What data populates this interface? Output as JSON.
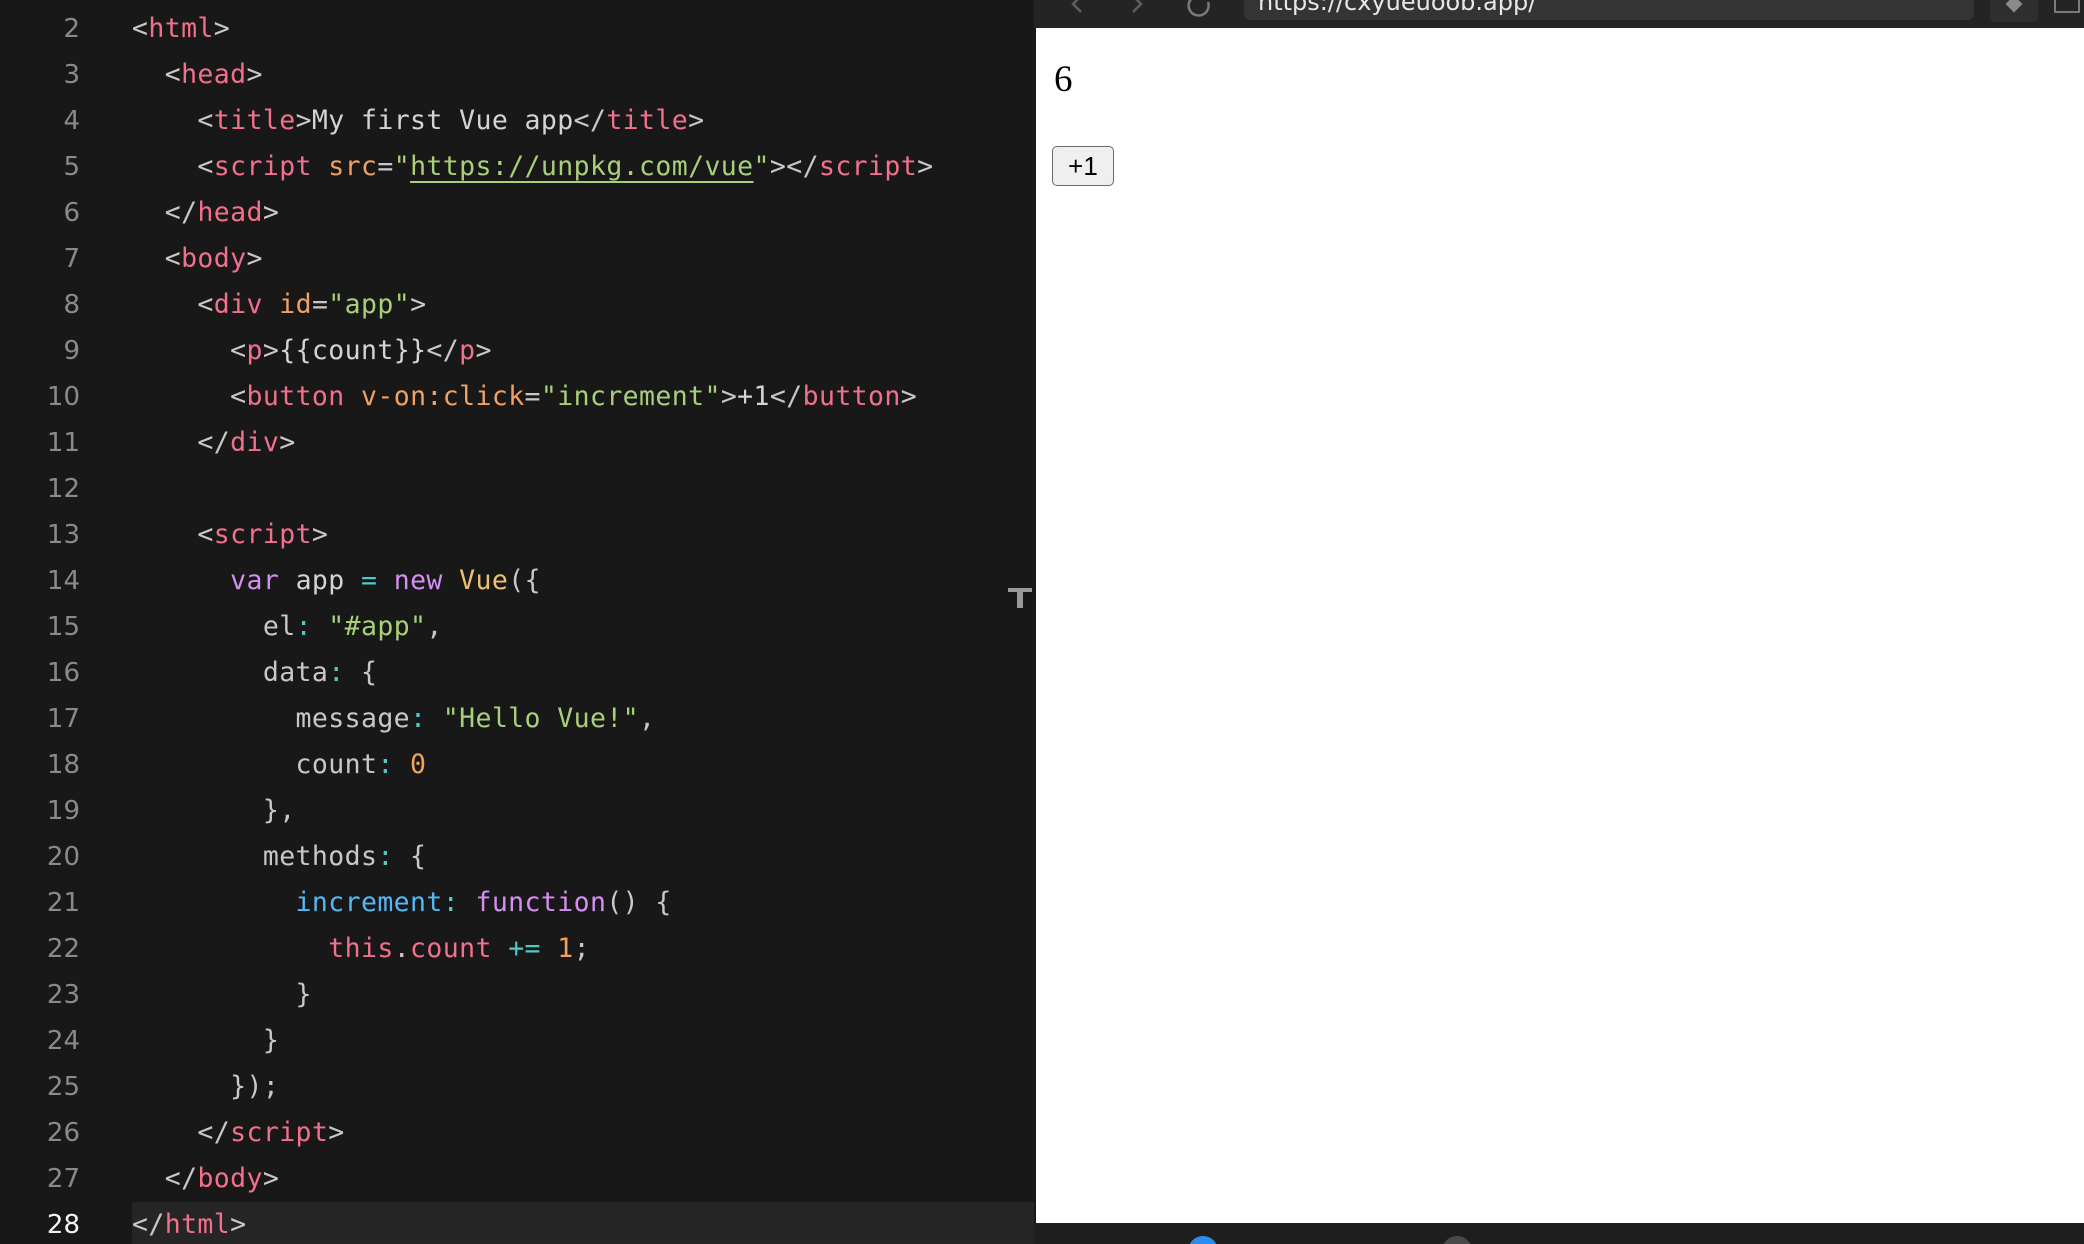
{
  "editor": {
    "current_line": 28,
    "lines": [
      {
        "n": "2",
        "tokens": [
          [
            "t-punct",
            "<"
          ],
          [
            "t-tag",
            "html"
          ],
          [
            "t-punct",
            ">"
          ]
        ]
      },
      {
        "n": "3",
        "tokens": [
          [
            "t-text",
            "  "
          ],
          [
            "t-punct",
            "<"
          ],
          [
            "t-tag",
            "head"
          ],
          [
            "t-punct",
            ">"
          ]
        ]
      },
      {
        "n": "4",
        "tokens": [
          [
            "t-text",
            "    "
          ],
          [
            "t-punct",
            "<"
          ],
          [
            "t-tag",
            "title"
          ],
          [
            "t-punct",
            ">"
          ],
          [
            "t-text",
            "My first Vue app"
          ],
          [
            "t-punct",
            "</"
          ],
          [
            "t-tag",
            "title"
          ],
          [
            "t-punct",
            ">"
          ]
        ]
      },
      {
        "n": "5",
        "tokens": [
          [
            "t-text",
            "    "
          ],
          [
            "t-punct",
            "<"
          ],
          [
            "t-tag",
            "script"
          ],
          [
            "t-text",
            " "
          ],
          [
            "t-attr",
            "src"
          ],
          [
            "t-punct",
            "="
          ],
          [
            "t-string",
            "\""
          ],
          [
            "t-link",
            "https://unpkg.com/vue"
          ],
          [
            "t-string",
            "\""
          ],
          [
            "t-punct",
            "></"
          ],
          [
            "t-tag",
            "script"
          ],
          [
            "t-punct",
            ">"
          ]
        ]
      },
      {
        "n": "6",
        "tokens": [
          [
            "t-text",
            "  "
          ],
          [
            "t-punct",
            "</"
          ],
          [
            "t-tag",
            "head"
          ],
          [
            "t-punct",
            ">"
          ]
        ]
      },
      {
        "n": "7",
        "tokens": [
          [
            "t-text",
            "  "
          ],
          [
            "t-punct",
            "<"
          ],
          [
            "t-tag",
            "body"
          ],
          [
            "t-punct",
            ">"
          ]
        ]
      },
      {
        "n": "8",
        "tokens": [
          [
            "t-text",
            "    "
          ],
          [
            "t-punct",
            "<"
          ],
          [
            "t-tag",
            "div"
          ],
          [
            "t-text",
            " "
          ],
          [
            "t-attr",
            "id"
          ],
          [
            "t-punct",
            "="
          ],
          [
            "t-string",
            "\"app\""
          ],
          [
            "t-punct",
            ">"
          ]
        ]
      },
      {
        "n": "9",
        "tokens": [
          [
            "t-text",
            "      "
          ],
          [
            "t-punct",
            "<"
          ],
          [
            "t-tag",
            "p"
          ],
          [
            "t-punct",
            ">"
          ],
          [
            "t-text",
            "{{count}}"
          ],
          [
            "t-punct",
            "</"
          ],
          [
            "t-tag",
            "p"
          ],
          [
            "t-punct",
            ">"
          ]
        ]
      },
      {
        "n": "10",
        "tokens": [
          [
            "t-text",
            "      "
          ],
          [
            "t-punct",
            "<"
          ],
          [
            "t-tag",
            "button"
          ],
          [
            "t-text",
            " "
          ],
          [
            "t-attr",
            "v-on:click"
          ],
          [
            "t-punct",
            "="
          ],
          [
            "t-string",
            "\"increment\""
          ],
          [
            "t-punct",
            ">"
          ],
          [
            "t-text",
            "+1"
          ],
          [
            "t-punct",
            "</"
          ],
          [
            "t-tag",
            "button"
          ],
          [
            "t-punct",
            ">"
          ]
        ]
      },
      {
        "n": "11",
        "tokens": [
          [
            "t-text",
            "    "
          ],
          [
            "t-punct",
            "</"
          ],
          [
            "t-tag",
            "div"
          ],
          [
            "t-punct",
            ">"
          ]
        ]
      },
      {
        "n": "12",
        "tokens": []
      },
      {
        "n": "13",
        "tokens": [
          [
            "t-text",
            "    "
          ],
          [
            "t-punct",
            "<"
          ],
          [
            "t-tag",
            "script"
          ],
          [
            "t-punct",
            ">"
          ]
        ]
      },
      {
        "n": "14",
        "tokens": [
          [
            "t-text",
            "      "
          ],
          [
            "t-keyword",
            "var"
          ],
          [
            "t-text",
            " app "
          ],
          [
            "t-op",
            "="
          ],
          [
            "t-text",
            " "
          ],
          [
            "t-keyword",
            "new"
          ],
          [
            "t-text",
            " "
          ],
          [
            "t-class",
            "Vue"
          ],
          [
            "t-punct",
            "({"
          ]
        ]
      },
      {
        "n": "15",
        "tokens": [
          [
            "t-text",
            "        "
          ],
          [
            "t-prop",
            "el"
          ],
          [
            "t-op",
            ":"
          ],
          [
            "t-text",
            " "
          ],
          [
            "t-string",
            "\"#app\""
          ],
          [
            "t-punct",
            ","
          ]
        ]
      },
      {
        "n": "16",
        "tokens": [
          [
            "t-text",
            "        "
          ],
          [
            "t-prop",
            "data"
          ],
          [
            "t-op",
            ":"
          ],
          [
            "t-text",
            " "
          ],
          [
            "t-punct",
            "{"
          ]
        ]
      },
      {
        "n": "17",
        "tokens": [
          [
            "t-text",
            "          "
          ],
          [
            "t-prop",
            "message"
          ],
          [
            "t-op",
            ":"
          ],
          [
            "t-text",
            " "
          ],
          [
            "t-string",
            "\"Hello Vue!\""
          ],
          [
            "t-punct",
            ","
          ]
        ]
      },
      {
        "n": "18",
        "tokens": [
          [
            "t-text",
            "          "
          ],
          [
            "t-prop",
            "count"
          ],
          [
            "t-op",
            ":"
          ],
          [
            "t-text",
            " "
          ],
          [
            "t-number",
            "0"
          ]
        ]
      },
      {
        "n": "19",
        "tokens": [
          [
            "t-text",
            "        "
          ],
          [
            "t-punct",
            "},"
          ]
        ]
      },
      {
        "n": "20",
        "tokens": [
          [
            "t-text",
            "        "
          ],
          [
            "t-prop",
            "methods"
          ],
          [
            "t-op",
            ":"
          ],
          [
            "t-text",
            " "
          ],
          [
            "t-punct",
            "{"
          ]
        ]
      },
      {
        "n": "21",
        "tokens": [
          [
            "t-text",
            "          "
          ],
          [
            "t-func",
            "increment"
          ],
          [
            "t-op",
            ":"
          ],
          [
            "t-text",
            " "
          ],
          [
            "t-keyword",
            "function"
          ],
          [
            "t-punct",
            "() {"
          ]
        ]
      },
      {
        "n": "22",
        "tokens": [
          [
            "t-text",
            "            "
          ],
          [
            "t-this",
            "this"
          ],
          [
            "t-punct",
            "."
          ],
          [
            "t-this",
            "count"
          ],
          [
            "t-text",
            " "
          ],
          [
            "t-op",
            "+="
          ],
          [
            "t-text",
            " "
          ],
          [
            "t-number",
            "1"
          ],
          [
            "t-punct",
            ";"
          ]
        ]
      },
      {
        "n": "23",
        "tokens": [
          [
            "t-text",
            "          "
          ],
          [
            "t-punct",
            "}"
          ]
        ]
      },
      {
        "n": "24",
        "tokens": [
          [
            "t-text",
            "        "
          ],
          [
            "t-punct",
            "}"
          ]
        ]
      },
      {
        "n": "25",
        "tokens": [
          [
            "t-text",
            "      "
          ],
          [
            "t-punct",
            "});"
          ]
        ]
      },
      {
        "n": "26",
        "tokens": [
          [
            "t-text",
            "    "
          ],
          [
            "t-punct",
            "</"
          ],
          [
            "t-tag",
            "script"
          ],
          [
            "t-punct",
            ">"
          ]
        ]
      },
      {
        "n": "27",
        "tokens": [
          [
            "t-text",
            "  "
          ],
          [
            "t-punct",
            "</"
          ],
          [
            "t-tag",
            "body"
          ],
          [
            "t-punct",
            ">"
          ]
        ]
      },
      {
        "n": "28",
        "tokens": [
          [
            "t-punct",
            "</"
          ],
          [
            "t-tag",
            "html"
          ],
          [
            "t-punct",
            ">"
          ]
        ]
      }
    ]
  },
  "browser": {
    "url": "https://cxyueuoob.app/",
    "icons": {
      "back": "back-arrow-icon",
      "forward": "forward-arrow-icon",
      "reload": "reload-icon",
      "extension": "extension-icon",
      "window": "window-icon"
    }
  },
  "preview": {
    "count": "6",
    "button_label": "+1"
  },
  "colors": {
    "editor_bg": "#181818",
    "tag": "#f2708a",
    "attr": "#f0a060",
    "string": "#a8d07a",
    "keyword": "#d58ef2",
    "function": "#54b8f5",
    "number": "#f3a15d"
  }
}
